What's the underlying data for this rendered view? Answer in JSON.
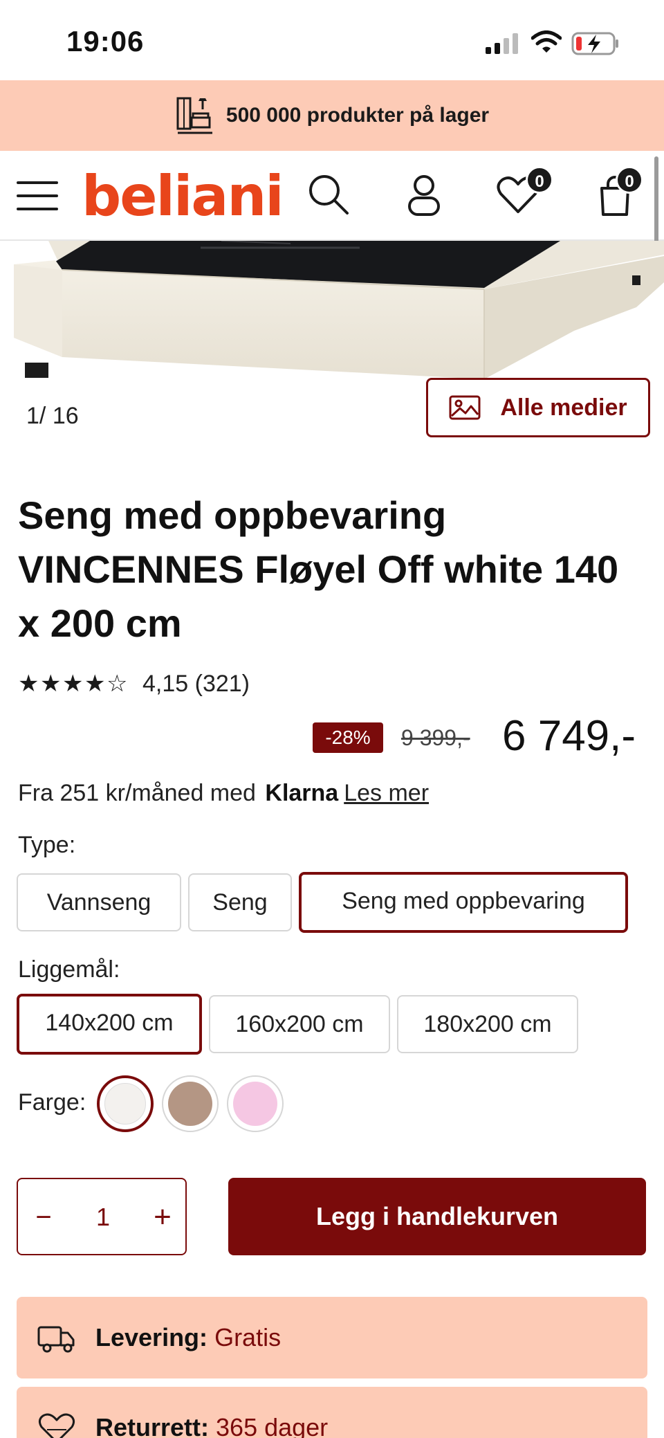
{
  "status_bar": {
    "time": "19:06"
  },
  "promo": {
    "text": "500 000 produkter på lager",
    "icon": "furniture-icon"
  },
  "header": {
    "logo": "beliani",
    "menu_icon": "hamburger-icon",
    "search_icon": "search-icon",
    "account_icon": "user-icon",
    "wishlist": {
      "icon": "heart-icon",
      "count": "0"
    },
    "cart": {
      "icon": "bag-icon",
      "count": "0"
    }
  },
  "gallery": {
    "counter_current": "1",
    "counter_total": "16",
    "media_button": "Alle medier"
  },
  "product": {
    "title": "Seng med oppbevaring VINCENNES Fløyel Off white 140 x 200 cm",
    "rating_stars": 4.15,
    "rating_text": "4,15 (321)",
    "discount": "-28%",
    "old_price": "9 399,-",
    "price": "6 749,-",
    "klarna": {
      "prefix": "Fra 251 kr/måned med",
      "brand": "Klarna",
      "link": "Les mer"
    }
  },
  "options": {
    "type": {
      "label": "Type:",
      "items": [
        "Vannseng",
        "Seng",
        "Seng med oppbevaring"
      ],
      "selected": "Seng med oppbevaring"
    },
    "size": {
      "label": "Liggemål:",
      "items": [
        "140x200 cm",
        "160x200 cm",
        "180x200 cm"
      ],
      "selected": "140x200 cm"
    },
    "color": {
      "label": "Farge:",
      "swatches": [
        "#f3f1ee",
        "#b49684",
        "#f5c7e3"
      ],
      "selected_index": 0
    }
  },
  "purchase": {
    "quantity": "1",
    "minus": "−",
    "plus": "+",
    "add_to_cart": "Legg i handlekurven"
  },
  "info": [
    {
      "key": "Levering:",
      "value": "Gratis",
      "icon": "truck-icon"
    },
    {
      "key": "Returrett:",
      "value": "365 dager",
      "icon": "return-365-icon"
    }
  ],
  "colors": {
    "accent": "#7a0b0b",
    "brand": "#e8451b",
    "promo_bg": "#fdcbb6"
  }
}
